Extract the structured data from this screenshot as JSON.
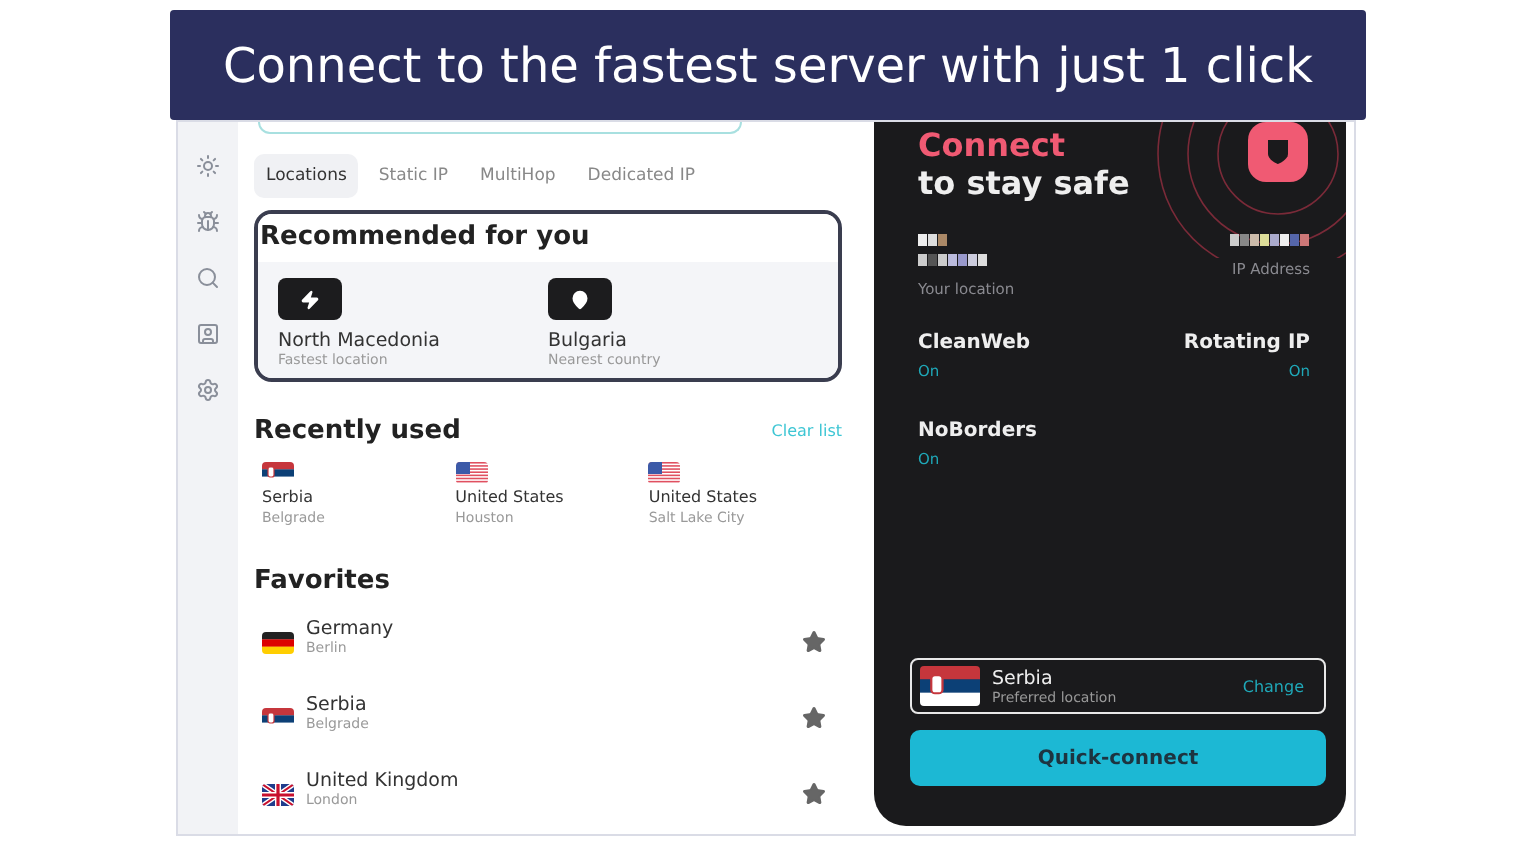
{
  "caption": "Connect to the fastest server with just 1 click",
  "tabs": [
    {
      "label": "Locations",
      "selected": true
    },
    {
      "label": "Static IP",
      "selected": false
    },
    {
      "label": "MultiHop",
      "selected": false
    },
    {
      "label": "Dedicated IP",
      "selected": false
    }
  ],
  "recommended": {
    "title": "Recommended for you",
    "items": [
      {
        "kind": "fastest",
        "name": "North Macedonia",
        "sub": "Fastest location"
      },
      {
        "kind": "nearest",
        "name": "Bulgaria",
        "sub": "Nearest country"
      }
    ]
  },
  "recent": {
    "title": "Recently used",
    "action": "Clear list",
    "items": [
      {
        "kind": "rs",
        "name": "Serbia",
        "city": "Belgrade"
      },
      {
        "kind": "us",
        "name": "United States",
        "city": "Houston"
      },
      {
        "kind": "us",
        "name": "United States",
        "city": "Salt Lake City"
      }
    ]
  },
  "favorites": {
    "title": "Favorites",
    "items": [
      {
        "kind": "de",
        "name": "Germany",
        "city": "Berlin",
        "favorite": true
      },
      {
        "kind": "rs",
        "name": "Serbia",
        "city": "Belgrade",
        "favorite": true
      },
      {
        "kind": "gb",
        "name": "United Kingdom",
        "city": "London",
        "favorite": true
      }
    ]
  },
  "connect": {
    "accent": "Connect",
    "title": "to stay safe",
    "location_label": "Your location",
    "ip_label": "IP Address",
    "features": [
      {
        "name": "CleanWeb",
        "status": "On",
        "on": true
      },
      {
        "name": "Rotating IP",
        "status": "On",
        "on": true
      },
      {
        "name": "NoBorders",
        "status": "On",
        "on": true
      }
    ],
    "preferred": {
      "kind": "rs",
      "name": "Serbia",
      "sub": "Preferred location",
      "action": "Change"
    },
    "button": "Quick-connect"
  }
}
